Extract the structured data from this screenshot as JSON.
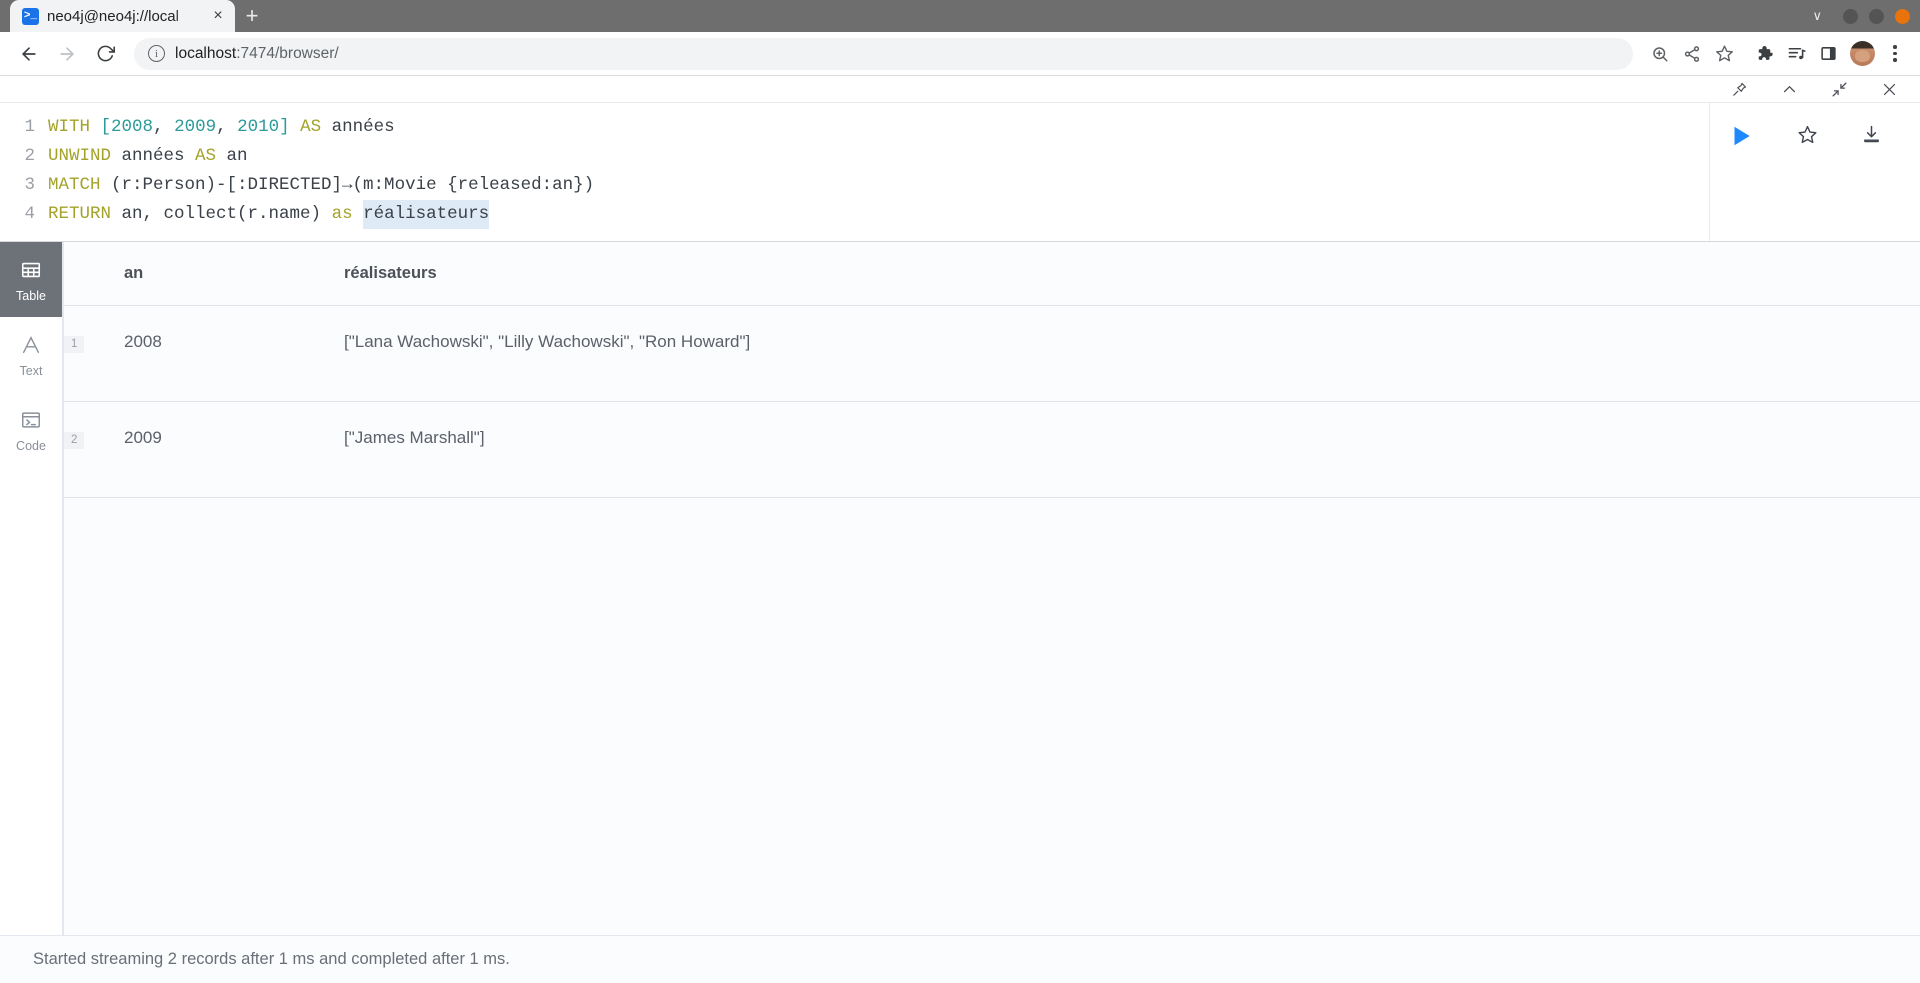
{
  "browser": {
    "tab": {
      "title": "neo4j@neo4j://local",
      "favicon_glyph": ">_",
      "close_glyph": "×"
    },
    "new_tab_glyph": "+",
    "window_controls": {
      "chevron_glyph": "∨",
      "minimize_color": "#545454",
      "maximize_color": "#545454",
      "close_color": "#e8720c"
    },
    "nav": {
      "back_glyph": "←",
      "forward_glyph": "→",
      "reload_glyph": "↻"
    },
    "omnibox": {
      "info_glyph": "i",
      "url_host": "localhost",
      "url_path": ":7474/browser/"
    },
    "toolbar_icons": [
      "zoom-icon",
      "share-icon",
      "bookmark-star-icon",
      "extensions-puzzle-icon",
      "media-list-icon",
      "side-panel-icon"
    ]
  },
  "frame": {
    "actions": [
      "pin-icon",
      "collapse-up-icon",
      "contract-icon",
      "close-icon"
    ]
  },
  "editor": {
    "lines": [
      {
        "n": "1",
        "tokens": [
          {
            "t": "WITH",
            "c": "kw"
          },
          {
            "t": " ",
            "c": "plain"
          },
          {
            "t": "[",
            "c": "punct"
          },
          {
            "t": "2008",
            "c": "num"
          },
          {
            "t": ", ",
            "c": "plain"
          },
          {
            "t": "2009",
            "c": "num"
          },
          {
            "t": ", ",
            "c": "plain"
          },
          {
            "t": "2010",
            "c": "num"
          },
          {
            "t": "]",
            "c": "punct"
          },
          {
            "t": " ",
            "c": "plain"
          },
          {
            "t": "AS",
            "c": "kw"
          },
          {
            "t": " années",
            "c": "plain"
          }
        ]
      },
      {
        "n": "2",
        "tokens": [
          {
            "t": "UNWIND",
            "c": "kw"
          },
          {
            "t": " années ",
            "c": "plain"
          },
          {
            "t": "AS",
            "c": "kw"
          },
          {
            "t": " an",
            "c": "plain"
          }
        ]
      },
      {
        "n": "3",
        "tokens": [
          {
            "t": "MATCH",
            "c": "kw"
          },
          {
            "t": " (r:Person)-[:DIRECTED]→(m:Movie {released:an})",
            "c": "plain"
          }
        ]
      },
      {
        "n": "4",
        "tokens": [
          {
            "t": "RETURN",
            "c": "kw"
          },
          {
            "t": " an, collect(r.name) ",
            "c": "plain"
          },
          {
            "t": "as",
            "c": "kw"
          },
          {
            "t": " ",
            "c": "plain"
          },
          {
            "t": "réalisateurs",
            "c": "sel"
          }
        ]
      }
    ],
    "run_button": "play-icon",
    "favorite_button": "star-icon",
    "download_button": "download-icon"
  },
  "view_sidebar": {
    "items": [
      {
        "label": "Table",
        "icon": "table-icon",
        "active": true
      },
      {
        "label": "Text",
        "icon": "text-a-icon",
        "active": false
      },
      {
        "label": "Code",
        "icon": "code-terminal-icon",
        "active": false
      }
    ]
  },
  "results": {
    "columns": [
      "an",
      "réalisateurs"
    ],
    "rows": [
      {
        "index": "1",
        "an": "2008",
        "realisateurs": "[\"Lana Wachowski\", \"Lilly Wachowski\", \"Ron Howard\"]"
      },
      {
        "index": "2",
        "an": "2009",
        "realisateurs": "[\"James Marshall\"]"
      }
    ]
  },
  "status": {
    "message": "Started streaming 2 records after 1 ms and completed after 1 ms."
  }
}
